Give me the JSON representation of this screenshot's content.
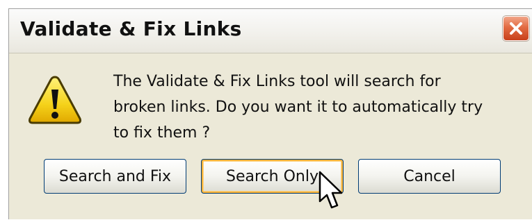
{
  "window": {
    "title": "Validate & Fix Links"
  },
  "icons": {
    "close": "close-icon",
    "warning": "warning-icon",
    "cursor": "mouse-pointer-icon"
  },
  "message": {
    "line1": "The Validate & Fix Links tool will search for",
    "line2": "broken links. Do you want it to automatically try",
    "line3": "to fix them ?"
  },
  "buttons": {
    "search_and_fix": "Search and Fix",
    "search_only": "Search Only",
    "cancel": "Cancel"
  },
  "colors": {
    "dialog_bg": "#ece9d8",
    "close_button": "#e26b42",
    "default_button_highlight": "#f8b33a",
    "warning_yellow": "#f5d21a"
  }
}
